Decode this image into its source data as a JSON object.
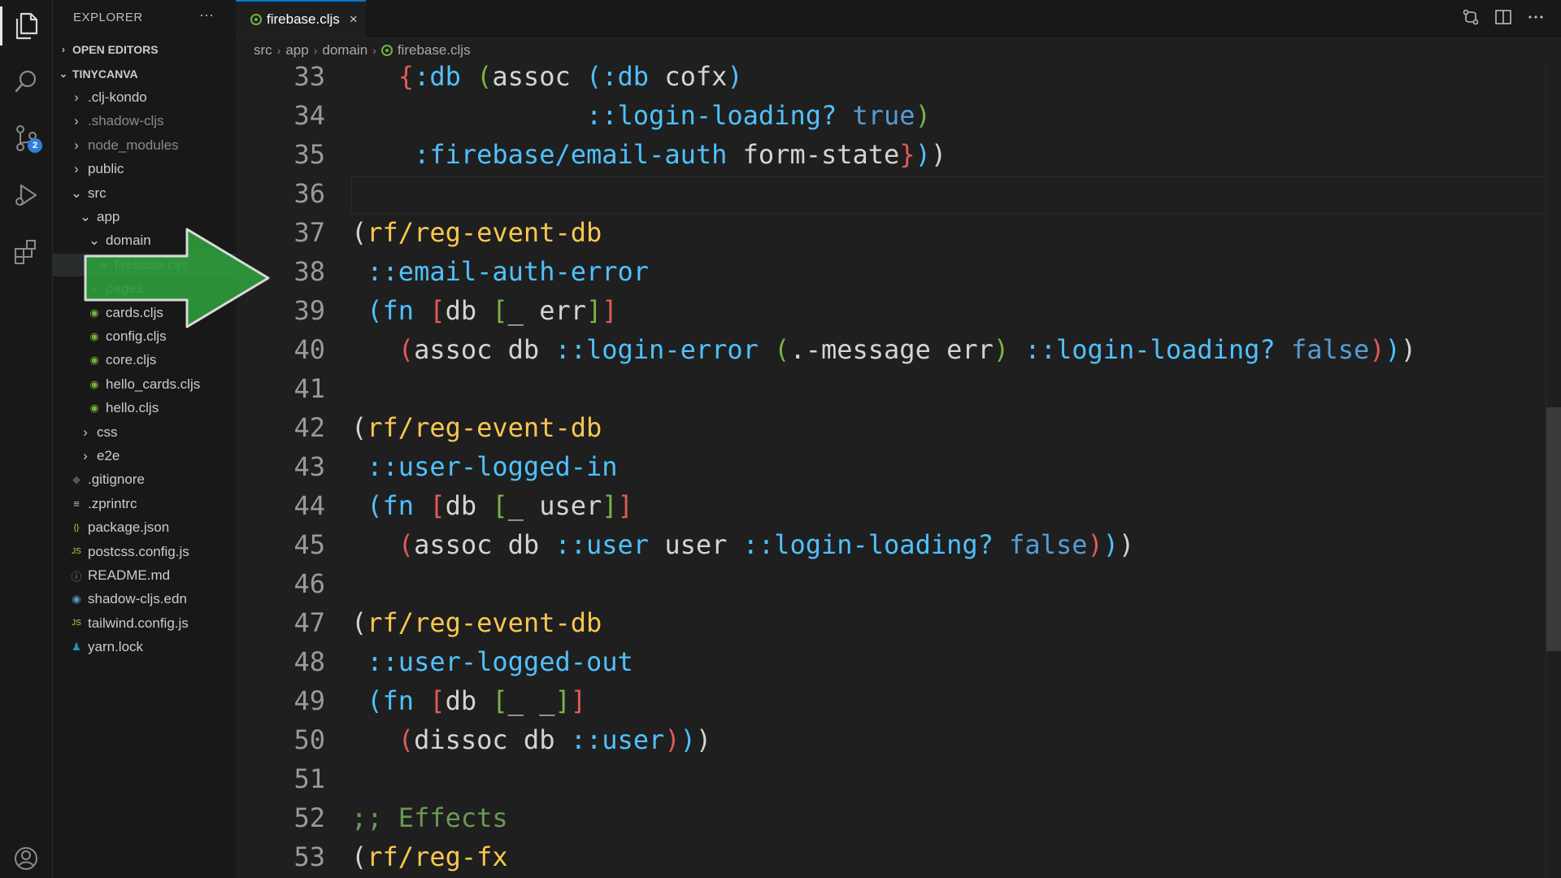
{
  "explorer": {
    "title": "EXPLORER",
    "more": "···",
    "open_editors": "OPEN EDITORS",
    "project": "TINYCANVA",
    "tree": [
      {
        "label": ".clj-kondo",
        "depth": 1,
        "type": "folder",
        "collapsed": true
      },
      {
        "label": ".shadow-cljs",
        "depth": 1,
        "type": "folder",
        "collapsed": true,
        "muted": true
      },
      {
        "label": "node_modules",
        "depth": 1,
        "type": "folder",
        "collapsed": true,
        "muted": true
      },
      {
        "label": "public",
        "depth": 1,
        "type": "folder",
        "collapsed": true
      },
      {
        "label": "src",
        "depth": 1,
        "type": "folder",
        "collapsed": false
      },
      {
        "label": "app",
        "depth": 2,
        "type": "folder",
        "collapsed": false
      },
      {
        "label": "domain",
        "depth": 3,
        "type": "folder",
        "collapsed": false
      },
      {
        "label": "firebase.cljs",
        "depth": 4,
        "type": "cljs",
        "selected": true
      },
      {
        "label": "pages",
        "depth": 3,
        "type": "folder",
        "collapsed": true
      },
      {
        "label": "cards.cljs",
        "depth": 3,
        "type": "cljs"
      },
      {
        "label": "config.cljs",
        "depth": 3,
        "type": "cljs"
      },
      {
        "label": "core.cljs",
        "depth": 3,
        "type": "cljs"
      },
      {
        "label": "hello_cards.cljs",
        "depth": 3,
        "type": "cljs"
      },
      {
        "label": "hello.cljs",
        "depth": 3,
        "type": "cljs"
      },
      {
        "label": "css",
        "depth": 2,
        "type": "folder",
        "collapsed": true
      },
      {
        "label": "e2e",
        "depth": 2,
        "type": "folder",
        "collapsed": true
      },
      {
        "label": ".gitignore",
        "depth": 1,
        "type": "git"
      },
      {
        "label": ".zprintrc",
        "depth": 1,
        "type": "lines"
      },
      {
        "label": "package.json",
        "depth": 1,
        "type": "json"
      },
      {
        "label": "postcss.config.js",
        "depth": 1,
        "type": "js"
      },
      {
        "label": "README.md",
        "depth": 1,
        "type": "info"
      },
      {
        "label": "shadow-cljs.edn",
        "depth": 1,
        "type": "edn"
      },
      {
        "label": "tailwind.config.js",
        "depth": 1,
        "type": "js"
      },
      {
        "label": "yarn.lock",
        "depth": 1,
        "type": "yarn"
      }
    ]
  },
  "activity": {
    "scm_badge": "2"
  },
  "tab": {
    "label": "firebase.cljs",
    "close": "×"
  },
  "breadcrumb": [
    "src",
    "app",
    "domain",
    "firebase.cljs"
  ],
  "colors": {
    "accent": "#0078d4",
    "arrow": "#2e9a3c",
    "cljs_icon": "#6fb33c"
  },
  "code_lines": [
    {
      "n": "33",
      "tokens": [
        [
          "   ",
          "txt"
        ],
        [
          "{",
          "pr"
        ],
        [
          ":db ",
          "kw"
        ],
        [
          "(",
          "pg"
        ],
        [
          "assoc ",
          "txt"
        ],
        [
          "(",
          "pb"
        ],
        [
          ":db ",
          "kw"
        ],
        [
          "cofx",
          "txt"
        ],
        [
          ")",
          "pb"
        ]
      ]
    },
    {
      "n": "34",
      "tokens": [
        [
          "               ",
          "txt"
        ],
        [
          "::login-loading? ",
          "kw"
        ],
        [
          "true",
          "bool"
        ],
        [
          ")",
          "pg"
        ]
      ]
    },
    {
      "n": "35",
      "tokens": [
        [
          "    ",
          "txt"
        ],
        [
          ":firebase/email-auth ",
          "kw"
        ],
        [
          "form-state",
          "txt"
        ],
        [
          "}",
          "pr"
        ],
        [
          ")",
          "pb"
        ],
        [
          ")",
          "txt"
        ]
      ]
    },
    {
      "n": "36",
      "tokens": []
    },
    {
      "n": "37",
      "tokens": [
        [
          "(",
          "txt"
        ],
        [
          "rf/reg-event-db",
          "p1"
        ]
      ]
    },
    {
      "n": "38",
      "tokens": [
        [
          " ",
          "txt"
        ],
        [
          "::email-auth-error",
          "kw"
        ]
      ]
    },
    {
      "n": "39",
      "tokens": [
        [
          " ",
          "txt"
        ],
        [
          "(",
          "pb"
        ],
        [
          "fn ",
          "kw"
        ],
        [
          "[",
          "pr"
        ],
        [
          "db ",
          "txt"
        ],
        [
          "[",
          "pg"
        ],
        [
          "_ err",
          "txt"
        ],
        [
          "]",
          "pg"
        ],
        [
          "]",
          "pr"
        ]
      ]
    },
    {
      "n": "40",
      "tokens": [
        [
          "   ",
          "txt"
        ],
        [
          "(",
          "pr"
        ],
        [
          "assoc db ",
          "txt"
        ],
        [
          "::login-error ",
          "kw"
        ],
        [
          "(",
          "pg"
        ],
        [
          ".-message err",
          "txt"
        ],
        [
          ") ",
          "pg"
        ],
        [
          "::login-loading? ",
          "kw"
        ],
        [
          "false",
          "bool"
        ],
        [
          ")",
          "pr"
        ],
        [
          ")",
          "pb"
        ],
        [
          ")",
          "txt"
        ]
      ]
    },
    {
      "n": "41",
      "tokens": []
    },
    {
      "n": "42",
      "tokens": [
        [
          "(",
          "txt"
        ],
        [
          "rf/reg-event-db",
          "p1"
        ]
      ]
    },
    {
      "n": "43",
      "tokens": [
        [
          " ",
          "txt"
        ],
        [
          "::user-logged-in",
          "kw"
        ]
      ]
    },
    {
      "n": "44",
      "tokens": [
        [
          " ",
          "txt"
        ],
        [
          "(",
          "pb"
        ],
        [
          "fn ",
          "kw"
        ],
        [
          "[",
          "pr"
        ],
        [
          "db ",
          "txt"
        ],
        [
          "[",
          "pg"
        ],
        [
          "_ user",
          "txt"
        ],
        [
          "]",
          "pg"
        ],
        [
          "]",
          "pr"
        ]
      ]
    },
    {
      "n": "45",
      "tokens": [
        [
          "   ",
          "txt"
        ],
        [
          "(",
          "pr"
        ],
        [
          "assoc db ",
          "txt"
        ],
        [
          "::user ",
          "kw"
        ],
        [
          "user ",
          "txt"
        ],
        [
          "::login-loading? ",
          "kw"
        ],
        [
          "false",
          "bool"
        ],
        [
          ")",
          "pr"
        ],
        [
          ")",
          "pb"
        ],
        [
          ")",
          "txt"
        ]
      ]
    },
    {
      "n": "46",
      "tokens": []
    },
    {
      "n": "47",
      "tokens": [
        [
          "(",
          "txt"
        ],
        [
          "rf/reg-event-db",
          "p1"
        ]
      ]
    },
    {
      "n": "48",
      "tokens": [
        [
          " ",
          "txt"
        ],
        [
          "::user-logged-out",
          "kw"
        ]
      ]
    },
    {
      "n": "49",
      "tokens": [
        [
          " ",
          "txt"
        ],
        [
          "(",
          "pb"
        ],
        [
          "fn ",
          "kw"
        ],
        [
          "[",
          "pr"
        ],
        [
          "db ",
          "txt"
        ],
        [
          "[",
          "pg"
        ],
        [
          "_ _",
          "txt"
        ],
        [
          "]",
          "pg"
        ],
        [
          "]",
          "pr"
        ]
      ]
    },
    {
      "n": "50",
      "tokens": [
        [
          "   ",
          "txt"
        ],
        [
          "(",
          "pr"
        ],
        [
          "dissoc db ",
          "txt"
        ],
        [
          "::user",
          "kw"
        ],
        [
          ")",
          "pr"
        ],
        [
          ")",
          "pb"
        ],
        [
          ")",
          "txt"
        ]
      ]
    },
    {
      "n": "51",
      "tokens": []
    },
    {
      "n": "52",
      "tokens": [
        [
          ";; Effects",
          "comment"
        ]
      ]
    },
    {
      "n": "53",
      "tokens": [
        [
          "(",
          "txt"
        ],
        [
          "rf/reg-fx",
          "p1"
        ]
      ]
    }
  ]
}
